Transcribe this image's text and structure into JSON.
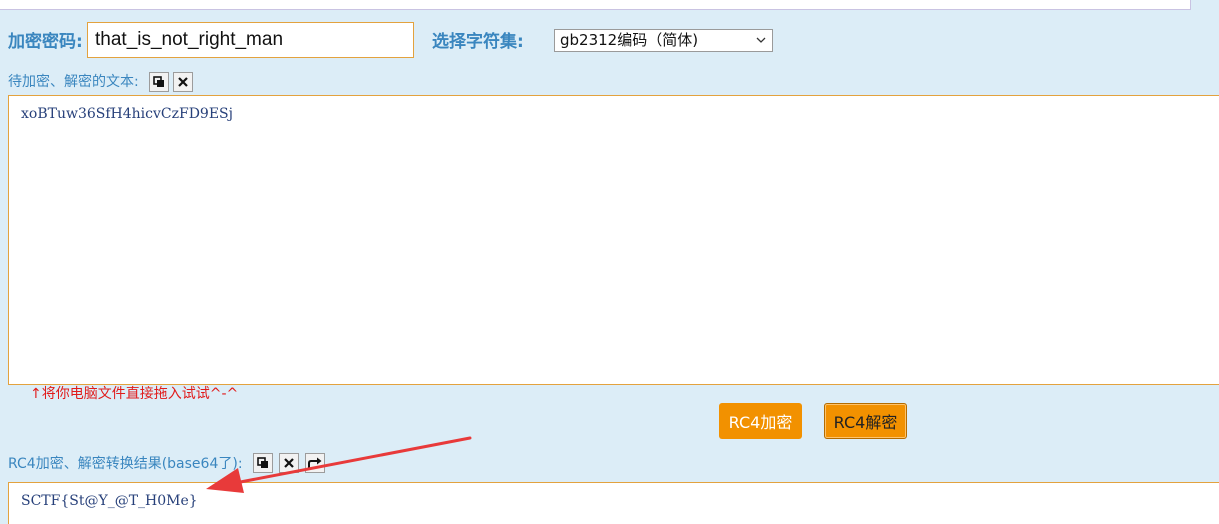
{
  "form": {
    "password_label": "加密密码:",
    "password_value": "that_is_not_right_man",
    "charset_label": "选择字符集:",
    "charset_selected": "gb2312编码（简体)"
  },
  "input_section": {
    "label": "待加密、解密的文本:",
    "text": "xoBTuw36SfH4hicvCzFD9ESj",
    "hint": "↑将你电脑文件直接拖入试试^-^"
  },
  "buttons": {
    "encrypt": "RC4加密",
    "decrypt": "RC4解密"
  },
  "result_section": {
    "label": "RC4加密、解密转换结果(base64了):",
    "text": "SCTF{St@Y_@T_H0Me}"
  },
  "icons": {
    "copy": "copy-icon",
    "clear": "clear-icon",
    "swap": "swap-icon",
    "dropdown": "chevron-down-icon",
    "annotation": "red-arrow-annotation"
  },
  "colors": {
    "background": "#dcedf7",
    "label_blue": "#3a86bf",
    "accent_orange": "#f29100",
    "border_orange": "#e3a23e",
    "hint_red": "#e11b1b",
    "annotation_red": "#e83a3a"
  }
}
